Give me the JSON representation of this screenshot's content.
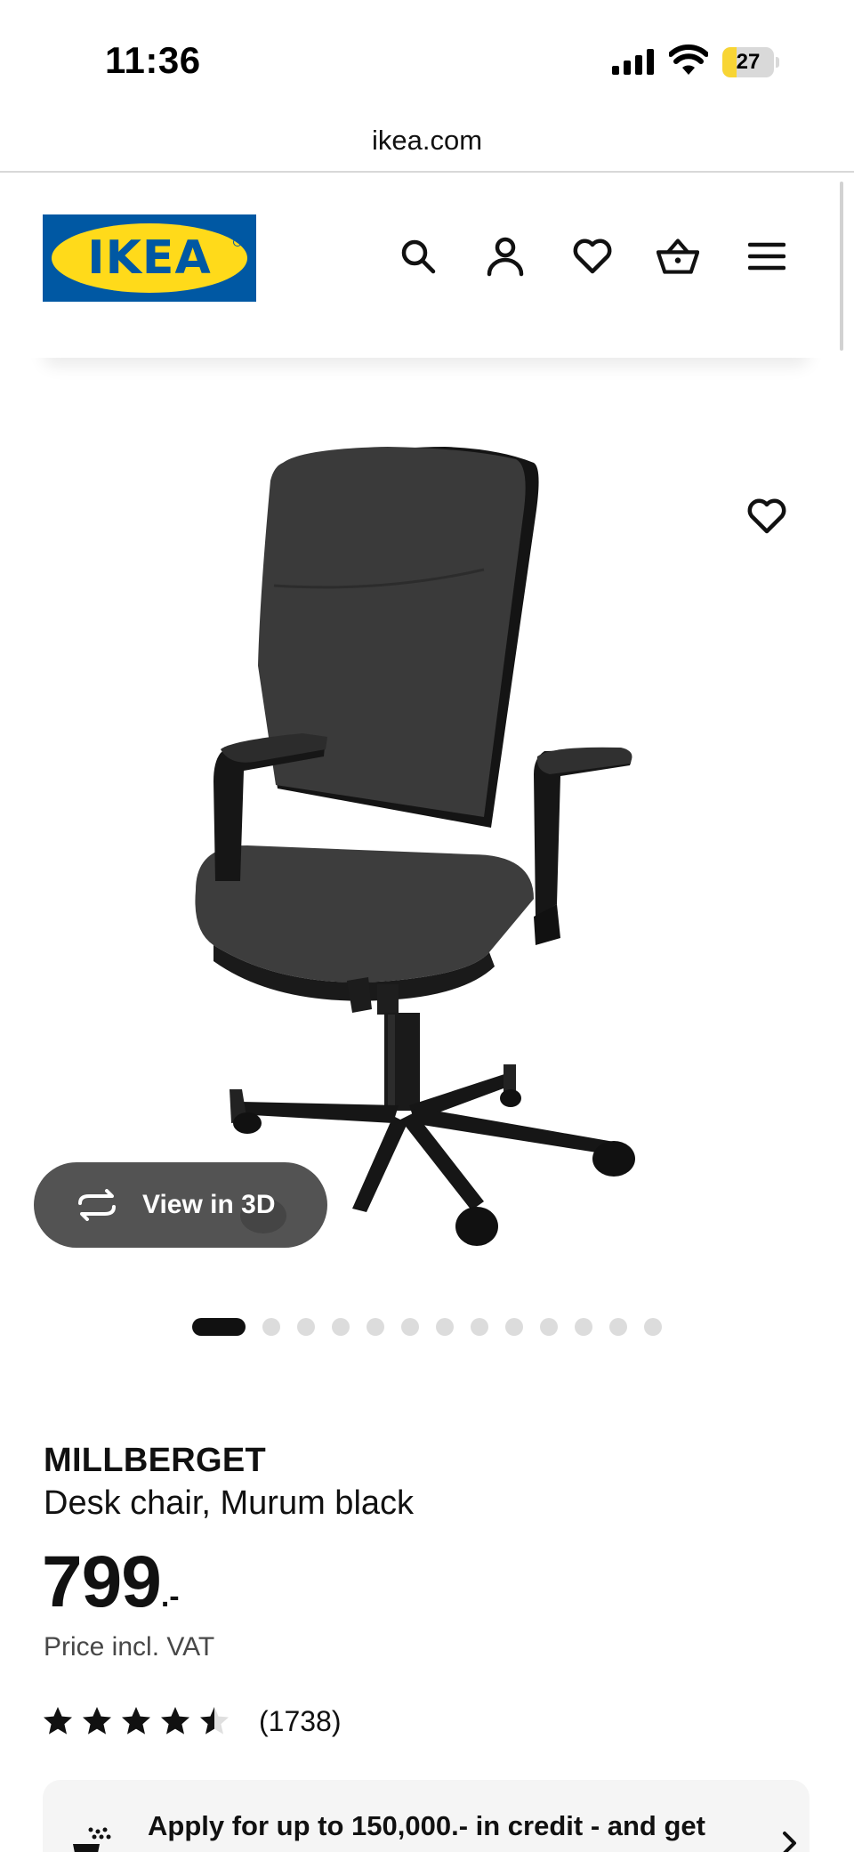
{
  "status_bar": {
    "time": "11:36",
    "battery_level": "27"
  },
  "browser": {
    "url": "ikea.com"
  },
  "header": {
    "logo_text": "IKEA",
    "icons": [
      "search-icon",
      "account-icon",
      "heart-icon",
      "basket-icon",
      "menu-icon"
    ]
  },
  "gallery": {
    "view_3d_label": "View in 3D",
    "image_count": 13,
    "active_index": 0
  },
  "product": {
    "name": "MILLBERGET",
    "description": "Desk chair, Murum black",
    "price": "799",
    "price_suffix": ".-",
    "price_note": "Price incl. VAT",
    "rating_value": 4.5,
    "rating_max": 5,
    "review_count": "(1738)"
  },
  "credit_banner": {
    "text": "Apply for up to 150,000.- in credit - and get"
  },
  "colors": {
    "ikea_blue": "#0058a3",
    "ikea_yellow": "#ffda1a",
    "text": "#111111"
  }
}
